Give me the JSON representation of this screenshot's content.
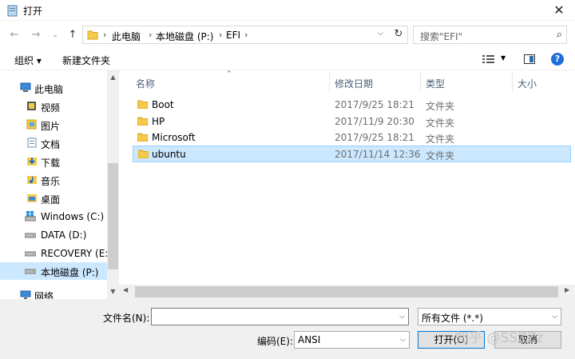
{
  "window": {
    "title": "打开",
    "close_glyph": "✕"
  },
  "nav": {
    "back_glyph": "←",
    "forward_glyph": "→",
    "recent_glyph": "⌄",
    "up_glyph": "↑",
    "breadcrumbs": [
      "此电脑",
      "本地磁盘 (P:)",
      "EFI"
    ],
    "sep_glyph": "›",
    "dropdown_glyph": "⌵",
    "refresh_glyph": "↻",
    "search_placeholder": "搜索\"EFI\"",
    "search_glyph": "⌕"
  },
  "toolbar": {
    "organize_label": "组织 ▾",
    "new_folder_label": "新建文件夹",
    "view_dd_glyph": "▼",
    "help_glyph": "?"
  },
  "sidebar": {
    "items": [
      {
        "label": "此电脑",
        "icon": "computer-icon"
      },
      {
        "label": "视频",
        "icon": "video-folder-icon"
      },
      {
        "label": "图片",
        "icon": "pictures-folder-icon"
      },
      {
        "label": "文档",
        "icon": "documents-folder-icon"
      },
      {
        "label": "下载",
        "icon": "download-folder-icon"
      },
      {
        "label": "音乐",
        "icon": "music-folder-icon"
      },
      {
        "label": "桌面",
        "icon": "desktop-folder-icon"
      },
      {
        "label": "Windows (C:)",
        "icon": "windows-drive-icon"
      },
      {
        "label": "DATA (D:)",
        "icon": "drive-icon"
      },
      {
        "label": "RECOVERY (E:)",
        "icon": "drive-icon"
      },
      {
        "label": "本地磁盘 (P:)",
        "icon": "drive-icon",
        "selected": true
      },
      {
        "label": "网络",
        "icon": "network-icon"
      }
    ],
    "scroll_up": "▲",
    "scroll_down": "▼"
  },
  "columns": {
    "name": "名称",
    "modified": "修改日期",
    "type": "类型",
    "size": "大小",
    "sort_glyph": "⌃"
  },
  "files": [
    {
      "name": "Boot",
      "modified": "2017/9/25 18:21",
      "type": "文件夹"
    },
    {
      "name": "HP",
      "modified": "2017/11/9 20:30",
      "type": "文件夹"
    },
    {
      "name": "Microsoft",
      "modified": "2017/9/25 18:21",
      "type": "文件夹"
    },
    {
      "name": "ubuntu",
      "modified": "2017/11/14 12:36",
      "type": "文件夹",
      "selected": true
    }
  ],
  "hscroll": {
    "left": "◀",
    "right": "▶"
  },
  "bottom": {
    "filename_label": "文件名(N):",
    "filename_value": "",
    "filetype_value": "所有文件 (*.*)",
    "encoding_label": "编码(E):",
    "encoding_value": "ANSI",
    "open_label": "打开(O)",
    "cancel_label": "取消",
    "dd_glyph": "⌵"
  },
  "watermark": "知乎 @SSZZz",
  "colors": {
    "selection": "#cce8ff",
    "folder": "#f5c94a",
    "accent": "#0078d7"
  }
}
